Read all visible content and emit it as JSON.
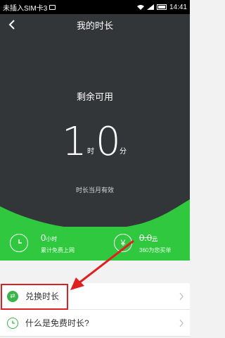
{
  "statusbar": {
    "carrier": "未插入SIM卡3",
    "time": "14:41"
  },
  "header": {
    "title": "我的时长"
  },
  "summary": {
    "remain_label": "剩余可用",
    "hours_value": "1",
    "hours_unit": "时",
    "minutes_value": "0",
    "minutes_unit": "分",
    "validity_note": "时长当月有效"
  },
  "stats": {
    "left": {
      "value": "0",
      "unit": "小时",
      "caption": "累计免费上网"
    },
    "right": {
      "value": "0.0",
      "unit": "元",
      "caption": "360为您买单"
    }
  },
  "list": {
    "items": [
      {
        "label": "兑换时长",
        "icon": "exchange-icon"
      },
      {
        "label": "什么是免费时长?",
        "icon": "clock-icon"
      }
    ]
  },
  "colors": {
    "header_bg": "#333638",
    "accent_green": "#2fc83f",
    "highlight_red": "#e02020"
  }
}
